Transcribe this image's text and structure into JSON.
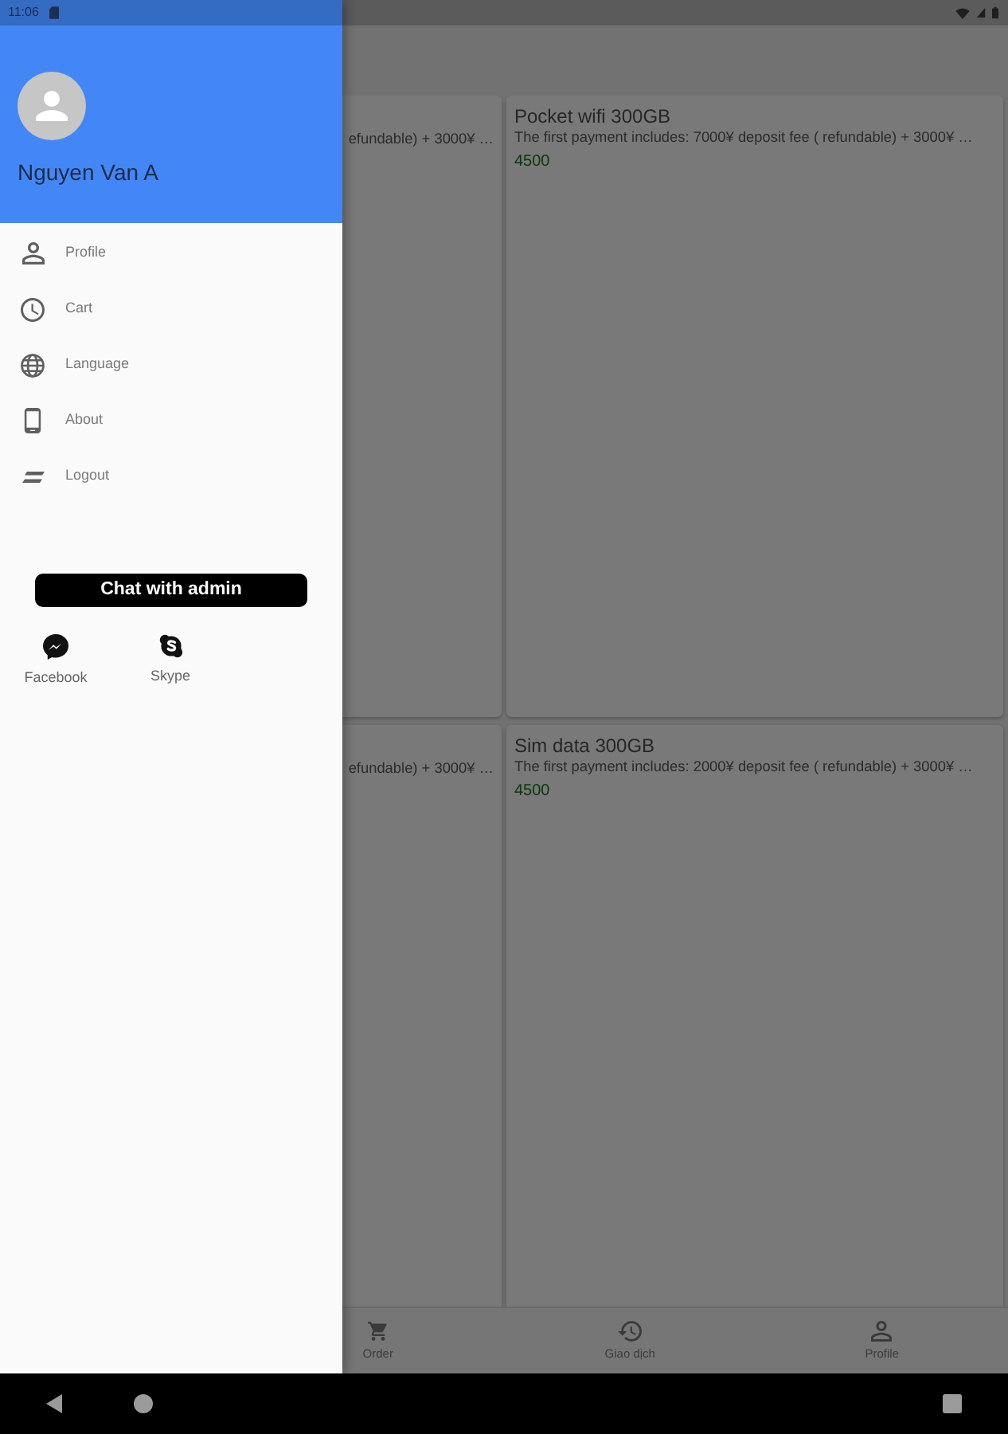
{
  "status_bar": {
    "time": "11:06"
  },
  "drawer": {
    "user_name": "Nguyen Van A",
    "menu": [
      {
        "label": "Profile"
      },
      {
        "label": "Cart"
      },
      {
        "label": "Language"
      },
      {
        "label": "About"
      },
      {
        "label": "Logout"
      }
    ],
    "chat_button": "Chat with admin",
    "contacts": [
      {
        "label": "Facebook"
      },
      {
        "label": "Skype"
      }
    ]
  },
  "products": [
    {
      "description": "efundable) + 3000¥ …"
    },
    {
      "title": "Pocket wifi 300GB",
      "description": "The first payment includes: 7000¥ deposit fee ( refundable) + 3000¥ …",
      "price": "4500"
    },
    {
      "description": "efundable) + 3000¥ …"
    },
    {
      "title": "Sim data 300GB",
      "description": "The first payment includes: 2000¥ deposit fee ( refundable) + 3000¥ …",
      "price": "4500"
    }
  ],
  "bottom_nav": [
    {
      "label": "Order",
      "selected": false
    },
    {
      "label": "Giao dịch",
      "selected": false
    },
    {
      "label": "Profile",
      "selected": false
    }
  ]
}
